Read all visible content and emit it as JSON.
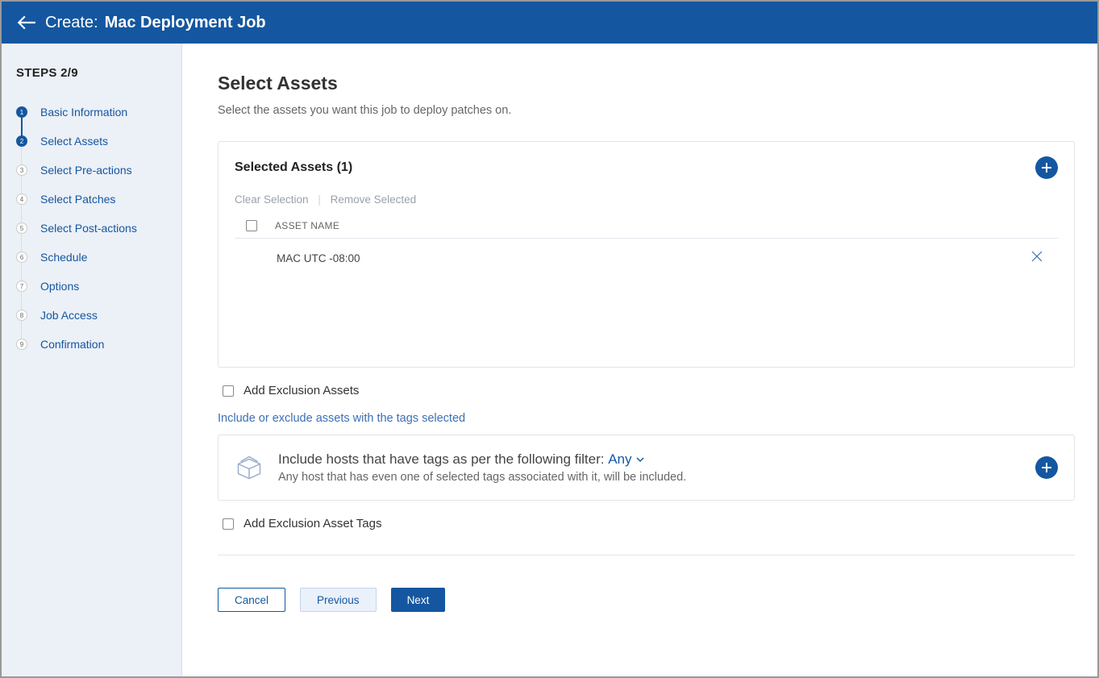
{
  "header": {
    "create_label": "Create:",
    "title": "Mac Deployment Job"
  },
  "sidebar": {
    "steps_label": "STEPS 2/9",
    "current": 2,
    "items": [
      {
        "n": "1",
        "label": "Basic Information",
        "state": "done"
      },
      {
        "n": "2",
        "label": "Select Assets",
        "state": "active"
      },
      {
        "n": "3",
        "label": "Select Pre-actions",
        "state": ""
      },
      {
        "n": "4",
        "label": "Select Patches",
        "state": ""
      },
      {
        "n": "5",
        "label": "Select Post-actions",
        "state": ""
      },
      {
        "n": "6",
        "label": "Schedule",
        "state": ""
      },
      {
        "n": "7",
        "label": "Options",
        "state": ""
      },
      {
        "n": "8",
        "label": "Job Access",
        "state": ""
      },
      {
        "n": "9",
        "label": "Confirmation",
        "state": ""
      }
    ]
  },
  "page": {
    "title": "Select Assets",
    "subtitle": "Select the assets you want this job to deploy patches on."
  },
  "assets": {
    "panel_title": "Selected Assets (1)",
    "clear": "Clear Selection",
    "remove": "Remove Selected",
    "col_name": "ASSET NAME",
    "rows": [
      {
        "name": "MAC UTC -08:00"
      }
    ]
  },
  "exclusion_assets_label": "Add Exclusion Assets",
  "tags_hint": "Include or exclude assets with the tags selected",
  "tags": {
    "title": "Include hosts that have tags as per the following filter:",
    "any": "Any",
    "sub": "Any host that has even one of selected tags associated with it, will be included."
  },
  "exclusion_tags_label": "Add Exclusion Asset Tags",
  "buttons": {
    "cancel": "Cancel",
    "previous": "Previous",
    "next": "Next"
  }
}
